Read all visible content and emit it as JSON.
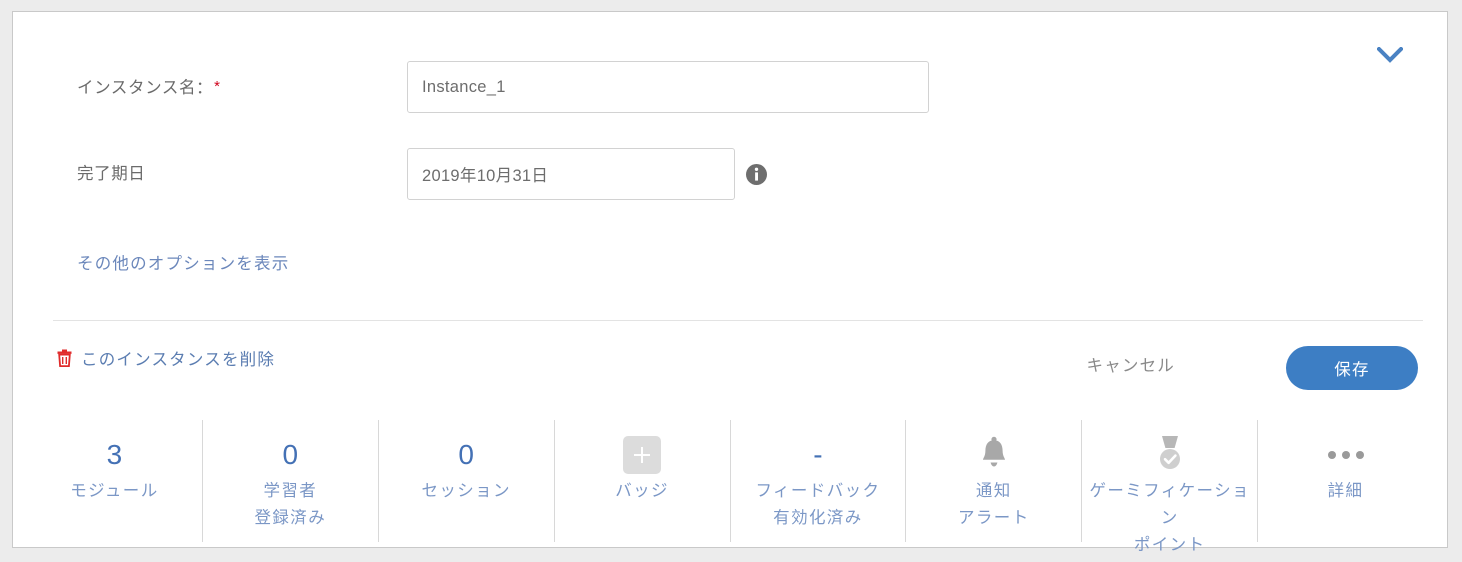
{
  "card": {
    "collapse_icon": "chevron-down-icon",
    "accent_blue": "#3d7ec4",
    "link_blue": "#5b7db1",
    "stat_blue": "#4471b5",
    "danger_red": "#d0021b"
  },
  "form": {
    "fields": [
      {
        "label": "インスタンス名：",
        "required_marker": "*",
        "value": "Instance_1",
        "placeholder": "Instance_1"
      },
      {
        "label": "完了期日",
        "required_marker": "",
        "value": "2019年10月31日",
        "placeholder": "2019年10月31日",
        "info_icon": "info-icon"
      }
    ],
    "more_options_link": "その他のオプションを表示"
  },
  "actions": {
    "delete_icon": "trash-icon",
    "delete_label": "このインスタンスを削除",
    "cancel_label": "キャンセル",
    "save_label": "保存"
  },
  "stats": [
    {
      "value": "3",
      "icon": "",
      "label": "モジュール"
    },
    {
      "value": "0",
      "icon": "",
      "label": "学習者\n登録済み"
    },
    {
      "value": "0",
      "icon": "",
      "label": "セッション"
    },
    {
      "value": "",
      "icon": "plus-square-icon",
      "label": "バッジ"
    },
    {
      "value": "-",
      "icon": "",
      "label": "フィードバック\n有効化済み"
    },
    {
      "value": "",
      "icon": "bell-icon",
      "label": "通知\nアラート"
    },
    {
      "value": "",
      "icon": "medal-icon",
      "label": "ゲーミフィケーション\nポイント"
    },
    {
      "value": "",
      "icon": "ellipsis-icon",
      "label": "詳細"
    }
  ]
}
